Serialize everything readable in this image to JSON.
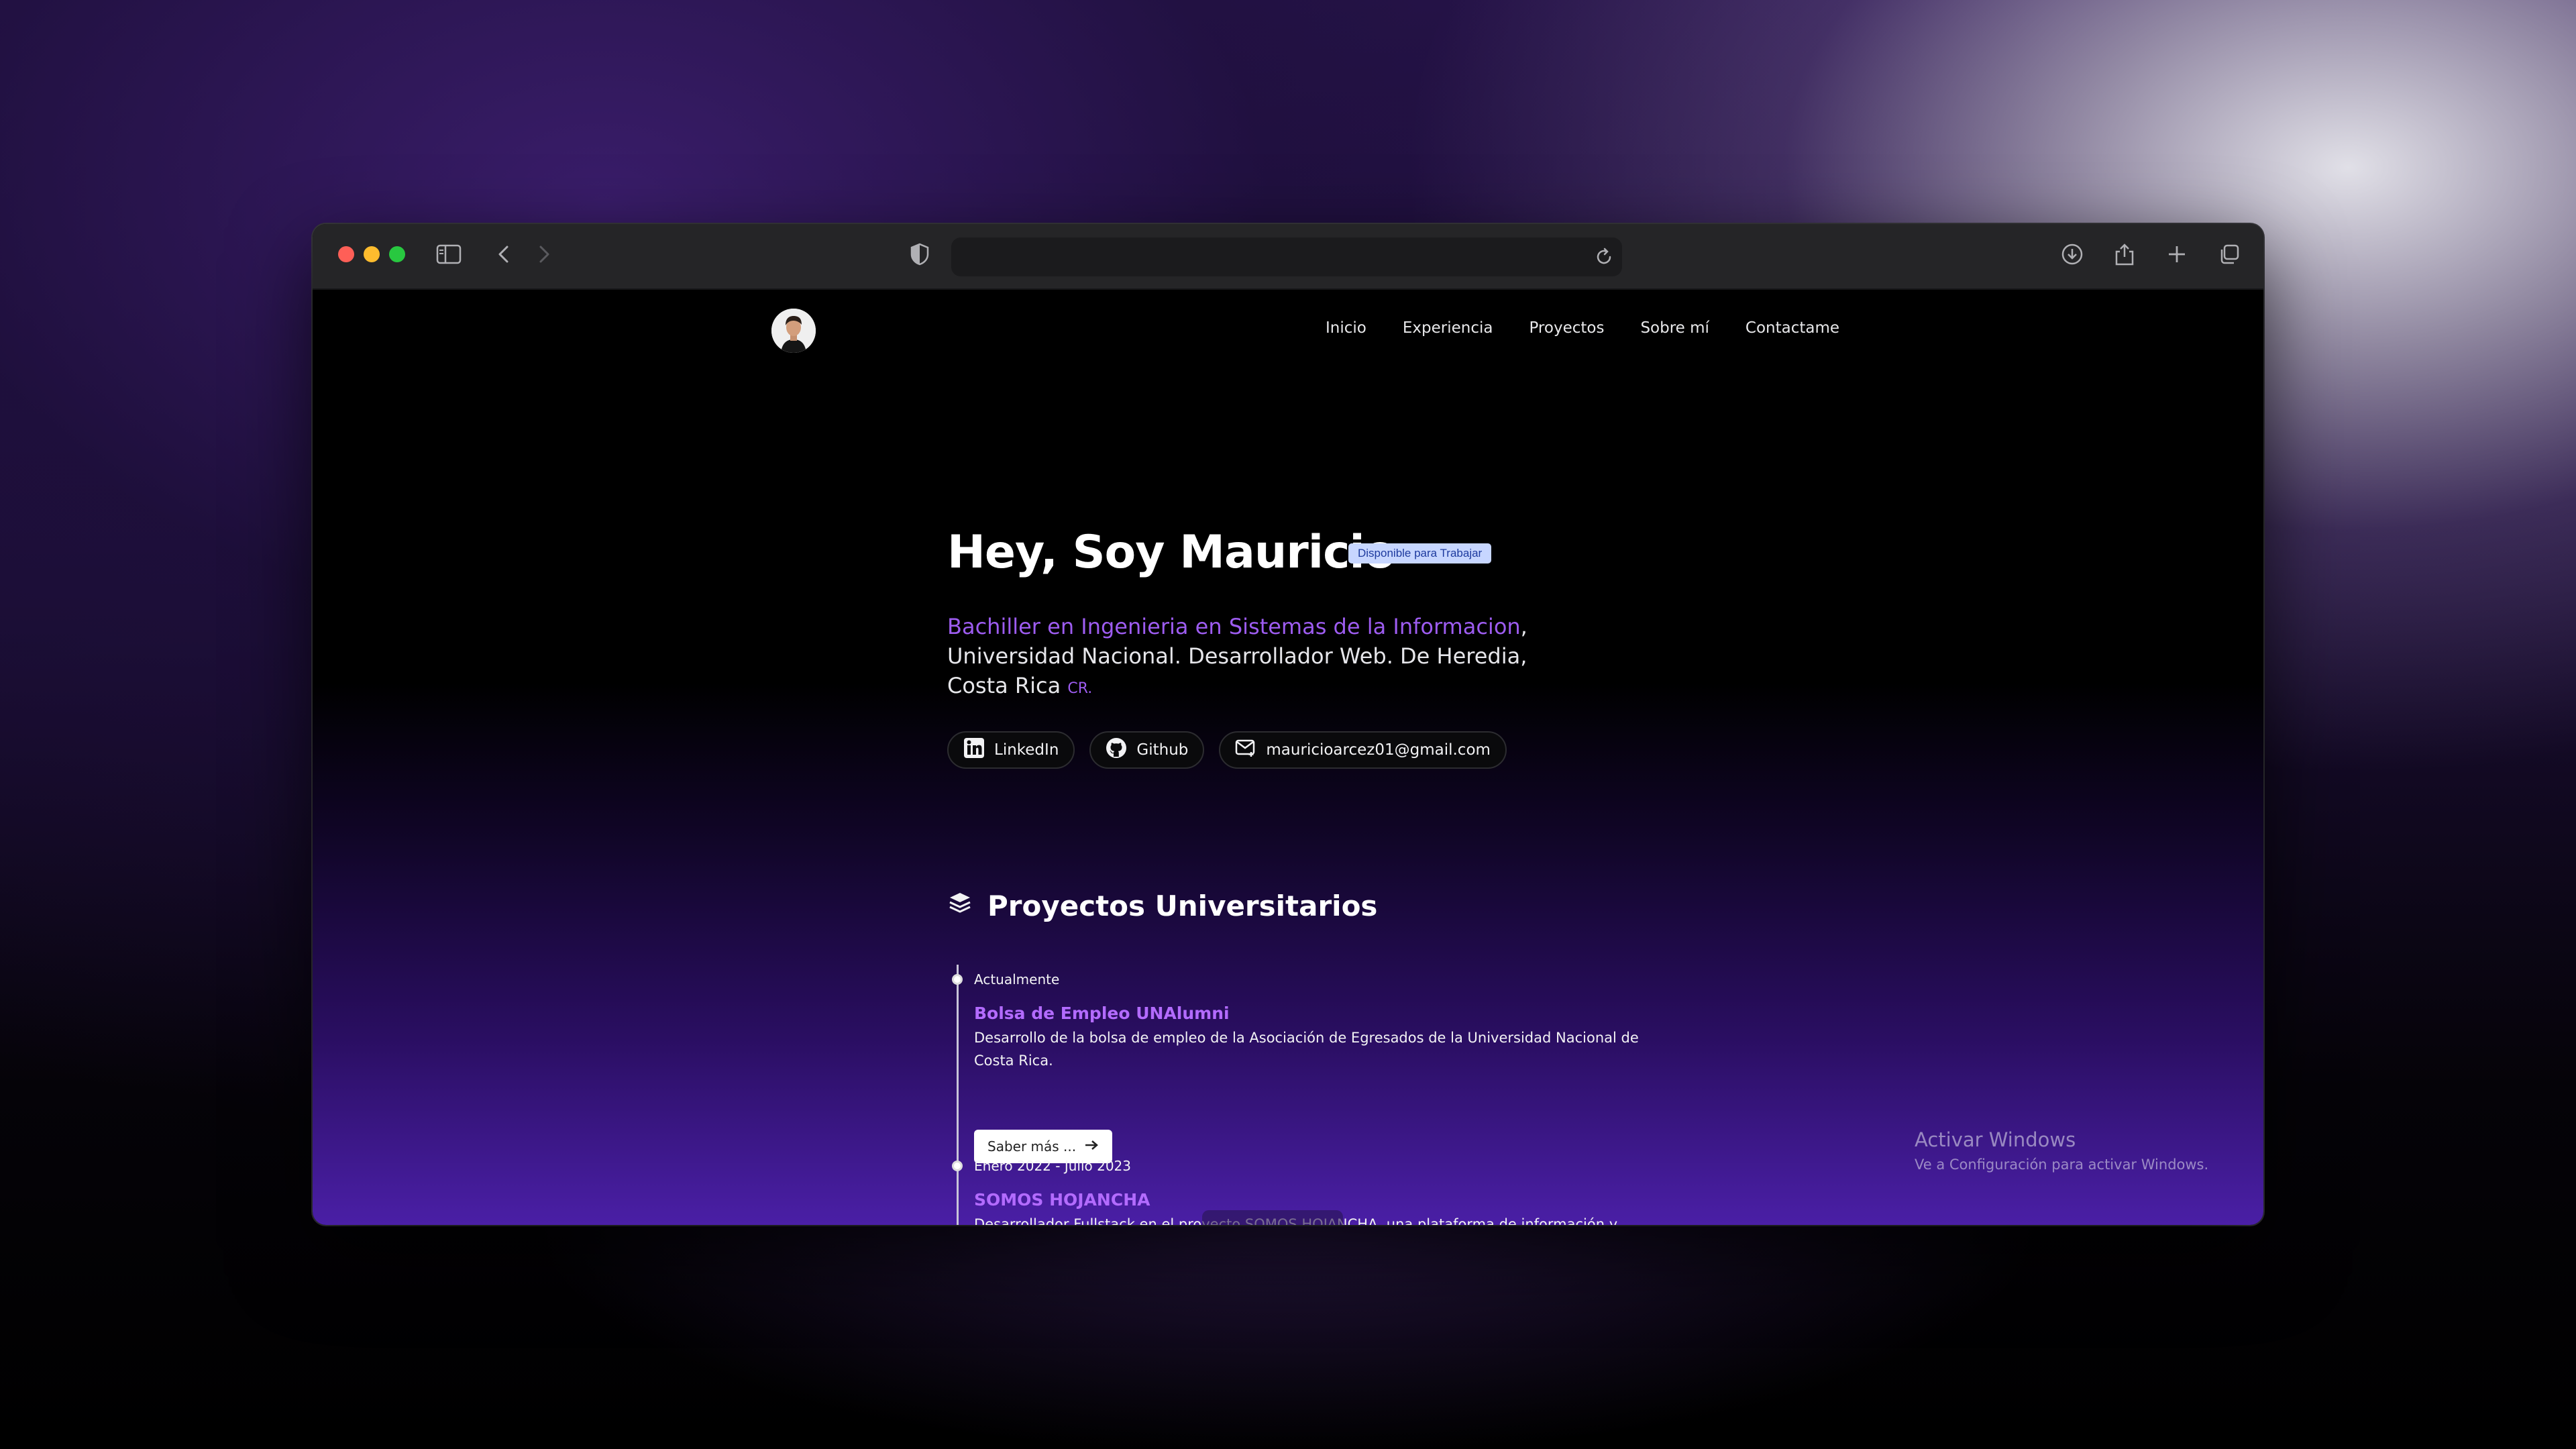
{
  "browser": {
    "url": "",
    "icons": [
      "sidebar-icon",
      "back-icon",
      "forward-icon",
      "shield-icon",
      "reload-icon",
      "download-icon",
      "share-icon",
      "new-tab-icon",
      "tabs-overview-icon"
    ]
  },
  "nav": {
    "items": [
      "Inicio",
      "Experiencia",
      "Proyectos",
      "Sobre mí",
      "Contactame"
    ]
  },
  "hero": {
    "title": "Hey, Soy Mauricio",
    "badge": "Disponible para Trabajar",
    "desc_accent": "Bachiller en Ingenieria en Sistemas de la Informacion",
    "desc_rest": "Universidad Nacional. Desarrollador Web. De Heredia, Costa Rica",
    "desc_suffix": "CR.",
    "links": {
      "linkedin": "LinkedIn",
      "github": "Github",
      "email": "mauricioarcez01@gmail.com"
    }
  },
  "projects": {
    "section_title": "Proyectos Universitarios",
    "items": [
      {
        "date": "Actualmente",
        "title": "Bolsa de Empleo UNAlumni",
        "desc": "Desarrollo de la bolsa de empleo de la Asociación de Egresados de la Universidad Nacional de Costa Rica.",
        "more": "Saber más ..."
      },
      {
        "date": "Enero 2022 - Julio 2023",
        "title": "SOMOS HOJANCHA",
        "desc": "Desarrollador Fullstack en el proyecto SOMOS HOJANCHA, una plataforma de información y servicios para la comunidad de Ho"
      }
    ]
  },
  "watermark": {
    "line1": "Activar Windows",
    "line2": "Ve a Configuración para activar Windows."
  },
  "colors": {
    "accent": "#9d5cf0",
    "badge_bg": "#c7d6ff",
    "traffic_red": "#ff5f57",
    "traffic_yellow": "#febc2e",
    "traffic_green": "#28c840"
  }
}
